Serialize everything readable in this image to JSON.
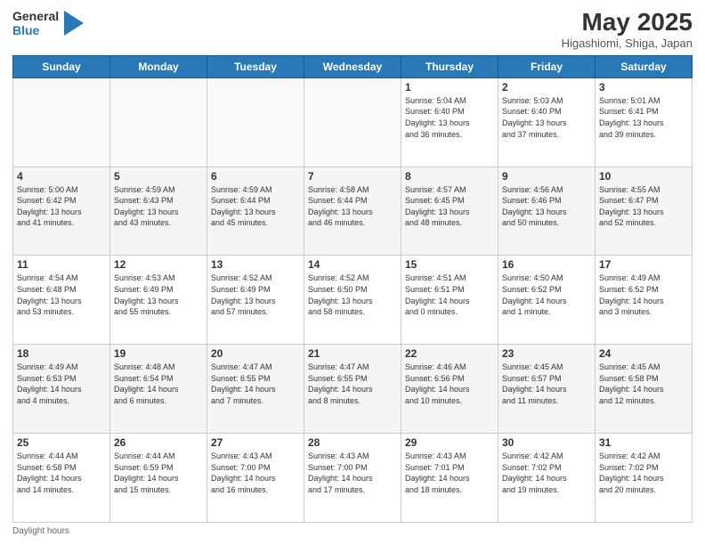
{
  "logo": {
    "general": "General",
    "blue": "Blue"
  },
  "title": "May 2025",
  "subtitle": "Higashiomi, Shiga, Japan",
  "days_header": [
    "Sunday",
    "Monday",
    "Tuesday",
    "Wednesday",
    "Thursday",
    "Friday",
    "Saturday"
  ],
  "weeks": [
    [
      {
        "num": "",
        "info": ""
      },
      {
        "num": "",
        "info": ""
      },
      {
        "num": "",
        "info": ""
      },
      {
        "num": "",
        "info": ""
      },
      {
        "num": "1",
        "info": "Sunrise: 5:04 AM\nSunset: 6:40 PM\nDaylight: 13 hours\nand 36 minutes."
      },
      {
        "num": "2",
        "info": "Sunrise: 5:03 AM\nSunset: 6:40 PM\nDaylight: 13 hours\nand 37 minutes."
      },
      {
        "num": "3",
        "info": "Sunrise: 5:01 AM\nSunset: 6:41 PM\nDaylight: 13 hours\nand 39 minutes."
      }
    ],
    [
      {
        "num": "4",
        "info": "Sunrise: 5:00 AM\nSunset: 6:42 PM\nDaylight: 13 hours\nand 41 minutes."
      },
      {
        "num": "5",
        "info": "Sunrise: 4:59 AM\nSunset: 6:43 PM\nDaylight: 13 hours\nand 43 minutes."
      },
      {
        "num": "6",
        "info": "Sunrise: 4:59 AM\nSunset: 6:44 PM\nDaylight: 13 hours\nand 45 minutes."
      },
      {
        "num": "7",
        "info": "Sunrise: 4:58 AM\nSunset: 6:44 PM\nDaylight: 13 hours\nand 46 minutes."
      },
      {
        "num": "8",
        "info": "Sunrise: 4:57 AM\nSunset: 6:45 PM\nDaylight: 13 hours\nand 48 minutes."
      },
      {
        "num": "9",
        "info": "Sunrise: 4:56 AM\nSunset: 6:46 PM\nDaylight: 13 hours\nand 50 minutes."
      },
      {
        "num": "10",
        "info": "Sunrise: 4:55 AM\nSunset: 6:47 PM\nDaylight: 13 hours\nand 52 minutes."
      }
    ],
    [
      {
        "num": "11",
        "info": "Sunrise: 4:54 AM\nSunset: 6:48 PM\nDaylight: 13 hours\nand 53 minutes."
      },
      {
        "num": "12",
        "info": "Sunrise: 4:53 AM\nSunset: 6:49 PM\nDaylight: 13 hours\nand 55 minutes."
      },
      {
        "num": "13",
        "info": "Sunrise: 4:52 AM\nSunset: 6:49 PM\nDaylight: 13 hours\nand 57 minutes."
      },
      {
        "num": "14",
        "info": "Sunrise: 4:52 AM\nSunset: 6:50 PM\nDaylight: 13 hours\nand 58 minutes."
      },
      {
        "num": "15",
        "info": "Sunrise: 4:51 AM\nSunset: 6:51 PM\nDaylight: 14 hours\nand 0 minutes."
      },
      {
        "num": "16",
        "info": "Sunrise: 4:50 AM\nSunset: 6:52 PM\nDaylight: 14 hours\nand 1 minute."
      },
      {
        "num": "17",
        "info": "Sunrise: 4:49 AM\nSunset: 6:52 PM\nDaylight: 14 hours\nand 3 minutes."
      }
    ],
    [
      {
        "num": "18",
        "info": "Sunrise: 4:49 AM\nSunset: 6:53 PM\nDaylight: 14 hours\nand 4 minutes."
      },
      {
        "num": "19",
        "info": "Sunrise: 4:48 AM\nSunset: 6:54 PM\nDaylight: 14 hours\nand 6 minutes."
      },
      {
        "num": "20",
        "info": "Sunrise: 4:47 AM\nSunset: 6:55 PM\nDaylight: 14 hours\nand 7 minutes."
      },
      {
        "num": "21",
        "info": "Sunrise: 4:47 AM\nSunset: 6:55 PM\nDaylight: 14 hours\nand 8 minutes."
      },
      {
        "num": "22",
        "info": "Sunrise: 4:46 AM\nSunset: 6:56 PM\nDaylight: 14 hours\nand 10 minutes."
      },
      {
        "num": "23",
        "info": "Sunrise: 4:45 AM\nSunset: 6:57 PM\nDaylight: 14 hours\nand 11 minutes."
      },
      {
        "num": "24",
        "info": "Sunrise: 4:45 AM\nSunset: 6:58 PM\nDaylight: 14 hours\nand 12 minutes."
      }
    ],
    [
      {
        "num": "25",
        "info": "Sunrise: 4:44 AM\nSunset: 6:58 PM\nDaylight: 14 hours\nand 14 minutes."
      },
      {
        "num": "26",
        "info": "Sunrise: 4:44 AM\nSunset: 6:59 PM\nDaylight: 14 hours\nand 15 minutes."
      },
      {
        "num": "27",
        "info": "Sunrise: 4:43 AM\nSunset: 7:00 PM\nDaylight: 14 hours\nand 16 minutes."
      },
      {
        "num": "28",
        "info": "Sunrise: 4:43 AM\nSunset: 7:00 PM\nDaylight: 14 hours\nand 17 minutes."
      },
      {
        "num": "29",
        "info": "Sunrise: 4:43 AM\nSunset: 7:01 PM\nDaylight: 14 hours\nand 18 minutes."
      },
      {
        "num": "30",
        "info": "Sunrise: 4:42 AM\nSunset: 7:02 PM\nDaylight: 14 hours\nand 19 minutes."
      },
      {
        "num": "31",
        "info": "Sunrise: 4:42 AM\nSunset: 7:02 PM\nDaylight: 14 hours\nand 20 minutes."
      }
    ]
  ],
  "footer": "Daylight hours"
}
